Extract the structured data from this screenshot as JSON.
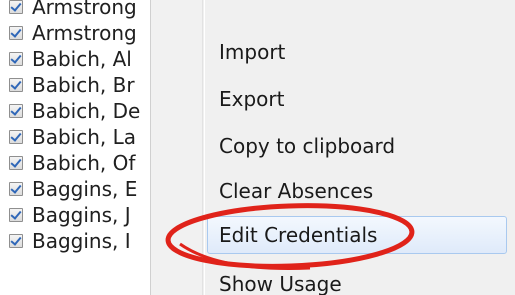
{
  "list": {
    "items": [
      {
        "label": "Armstrong",
        "checked": true
      },
      {
        "label": "Armstrong",
        "checked": true
      },
      {
        "label": "Babich, Al",
        "checked": true
      },
      {
        "label": "Babich, Br",
        "checked": true
      },
      {
        "label": "Babich, De",
        "checked": true
      },
      {
        "label": "Babich, La",
        "checked": true
      },
      {
        "label": "Babich, Of",
        "checked": true
      },
      {
        "label": "Baggins, E",
        "checked": true
      },
      {
        "label": "Baggins, J",
        "checked": true
      },
      {
        "label": "Baggins, I",
        "checked": true
      }
    ]
  },
  "menu": {
    "items": [
      {
        "label": "Import"
      },
      {
        "label": "Export"
      },
      {
        "label": "Copy to clipboard"
      },
      {
        "label": "Clear Absences"
      },
      {
        "label": "Edit Credentials",
        "highlighted": true
      },
      {
        "label": "Show Usage"
      }
    ]
  },
  "colors": {
    "annotation": "#e0231a",
    "highlight_border": "#a9c9ef",
    "menu_background": "#f0f0f0",
    "checkmark": "#2f67b8"
  }
}
